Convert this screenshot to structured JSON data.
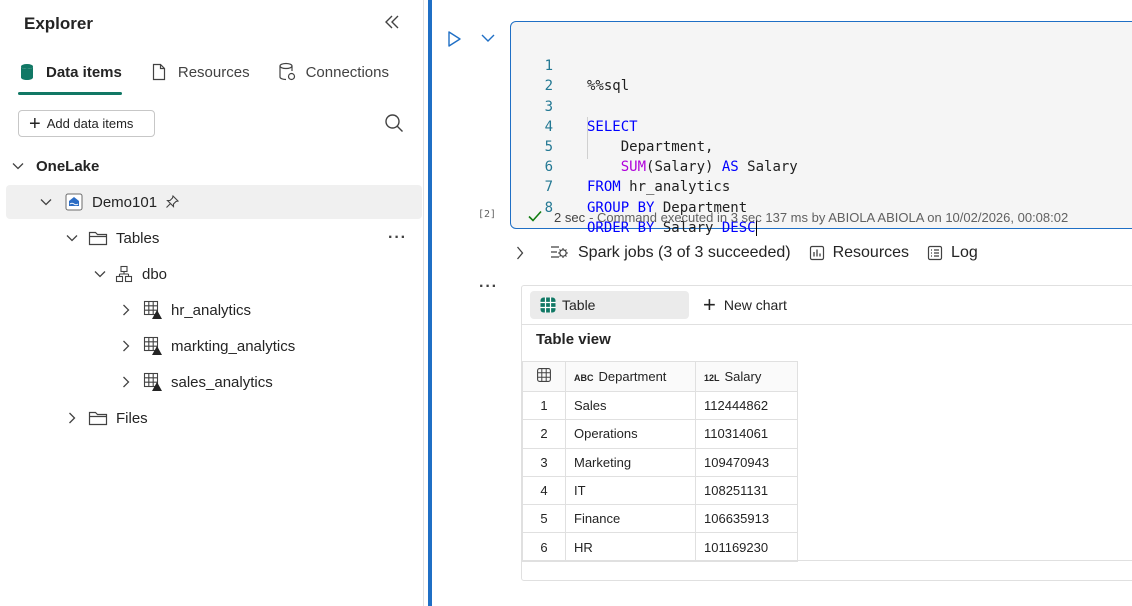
{
  "explorer": {
    "title": "Explorer",
    "tabs": [
      {
        "label": "Data items",
        "icon": "database-icon",
        "active": true
      },
      {
        "label": "Resources",
        "icon": "document-icon",
        "active": false
      },
      {
        "label": "Connections",
        "icon": "connection-icon",
        "active": false
      }
    ],
    "add_button": "Add data items",
    "tree": {
      "root": "OneLake",
      "lakehouse": "Demo101",
      "tables_folder": "Tables",
      "schema": "dbo",
      "tables": [
        "hr_analytics",
        "markting_analytics",
        "sales_analytics"
      ],
      "files_folder": "Files"
    }
  },
  "cell": {
    "code_lines": [
      {
        "n": "1",
        "text": "%%sql"
      },
      {
        "n": "2",
        "text": ""
      },
      {
        "n": "3",
        "text": "SELECT"
      },
      {
        "n": "4",
        "text": "    Department,"
      },
      {
        "n": "5",
        "text": "    SUM(Salary) AS Salary"
      },
      {
        "n": "6",
        "text": "FROM hr_analytics"
      },
      {
        "n": "7",
        "text": "GROUP BY Department"
      },
      {
        "n": "8",
        "text": "ORDER BY Salary DESC"
      }
    ],
    "exec_count": "[2]",
    "status_duration": "2 sec",
    "status_text": "- Command executed in 3 sec 137 ms by ABIOLA ABIOLA on 10/02/2026, 00:08:02"
  },
  "toolbar": {
    "spark_jobs": "Spark jobs (3 of 3 succeeded)",
    "resources": "Resources",
    "log": "Log"
  },
  "output": {
    "tab_table": "Table",
    "tab_new_chart": "New chart",
    "table_view_title": "Table view",
    "columns": [
      {
        "type": "ABC",
        "name": "Department"
      },
      {
        "type": "12L",
        "name": "Salary"
      }
    ],
    "rows": [
      {
        "idx": "1",
        "department": "Sales",
        "salary": "112444862"
      },
      {
        "idx": "2",
        "department": "Operations",
        "salary": "110314061"
      },
      {
        "idx": "3",
        "department": "Marketing",
        "salary": "109470943"
      },
      {
        "idx": "4",
        "department": "IT",
        "salary": "108251131"
      },
      {
        "idx": "5",
        "department": "Finance",
        "salary": "106635913"
      },
      {
        "idx": "6",
        "department": "HR",
        "salary": "101169230"
      }
    ]
  },
  "colors": {
    "accent_blue": "#1f6fc5",
    "active_tab_underline": "#117865",
    "keyword_blue": "#0000ff",
    "function_purple": "#af00db",
    "success_green": "#107c10"
  }
}
